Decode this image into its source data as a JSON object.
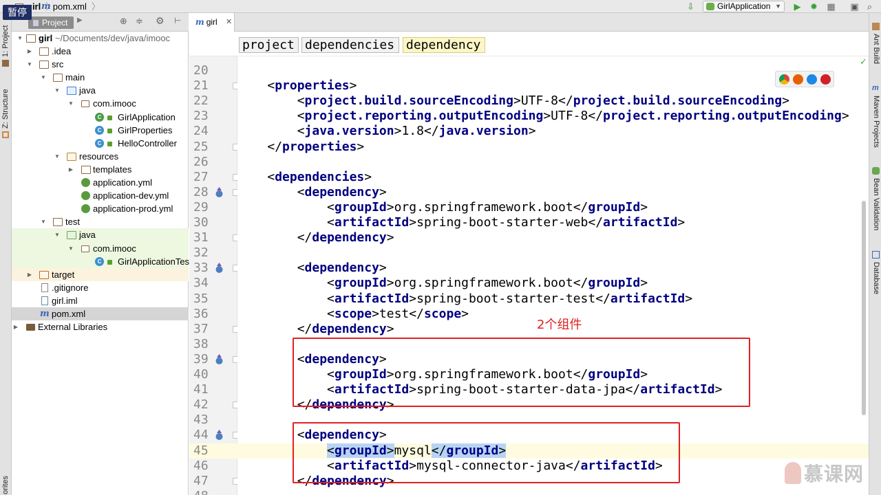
{
  "topbar": {
    "crumbs": [
      "girl",
      "pom.xml"
    ],
    "pause_label": "暂停",
    "run_config": "GirlApplication"
  },
  "left_strip": {
    "project_label": "1: Project",
    "structure_label": "Z: Structure",
    "favorites_label": "orites"
  },
  "right_strip": {
    "tools": [
      "Ant Build",
      "Maven Projects",
      "Bean Validation",
      "Database"
    ]
  },
  "project_panel": {
    "title": "Project",
    "tree": [
      {
        "label": "girl",
        "suffix": "~/Documents/dev/java/imooc",
        "bold": true
      },
      {
        "label": ".idea"
      },
      {
        "label": "src"
      },
      {
        "label": "main"
      },
      {
        "label": "java"
      },
      {
        "label": "com.imooc"
      },
      {
        "label": "GirlApplication"
      },
      {
        "label": "GirlProperties"
      },
      {
        "label": "HelloController"
      },
      {
        "label": "resources"
      },
      {
        "label": "templates"
      },
      {
        "label": "application.yml"
      },
      {
        "label": "application-dev.yml"
      },
      {
        "label": "application-prod.yml"
      },
      {
        "label": "test"
      },
      {
        "label": "java"
      },
      {
        "label": "com.imooc"
      },
      {
        "label": "GirlApplicationTests"
      },
      {
        "label": "target"
      },
      {
        "label": ".gitignore"
      },
      {
        "label": "girl.iml"
      },
      {
        "label": "pom.xml"
      },
      {
        "label": "External Libraries"
      }
    ]
  },
  "editor": {
    "tab_label": "girl",
    "breadcrumb": [
      "project",
      "dependencies",
      "dependency"
    ],
    "lines": [
      {
        "n": "20",
        "text": ""
      },
      {
        "n": "21",
        "text": "    <properties>"
      },
      {
        "n": "22",
        "text": "        <project.build.sourceEncoding>UTF-8</project.build.sourceEncoding>"
      },
      {
        "n": "23",
        "text": "        <project.reporting.outputEncoding>UTF-8</project.reporting.outputEncoding>"
      },
      {
        "n": "24",
        "text": "        <java.version>1.8</java.version>"
      },
      {
        "n": "25",
        "text": "    </properties>"
      },
      {
        "n": "26",
        "text": ""
      },
      {
        "n": "27",
        "text": "    <dependencies>"
      },
      {
        "n": "28",
        "text": "        <dependency>"
      },
      {
        "n": "29",
        "text": "            <groupId>org.springframework.boot</groupId>"
      },
      {
        "n": "30",
        "text": "            <artifactId>spring-boot-starter-web</artifactId>"
      },
      {
        "n": "31",
        "text": "        </dependency>"
      },
      {
        "n": "32",
        "text": ""
      },
      {
        "n": "33",
        "text": "        <dependency>"
      },
      {
        "n": "34",
        "text": "            <groupId>org.springframework.boot</groupId>"
      },
      {
        "n": "35",
        "text": "            <artifactId>spring-boot-starter-test</artifactId>"
      },
      {
        "n": "36",
        "text": "            <scope>test</scope>"
      },
      {
        "n": "37",
        "text": "        </dependency>"
      },
      {
        "n": "38",
        "text": ""
      },
      {
        "n": "39",
        "text": "        <dependency>"
      },
      {
        "n": "40",
        "text": "            <groupId>org.springframework.boot</groupId>"
      },
      {
        "n": "41",
        "text": "            <artifactId>spring-boot-starter-data-jpa</artifactId>"
      },
      {
        "n": "42",
        "text": "        </dependency>"
      },
      {
        "n": "43",
        "text": ""
      },
      {
        "n": "44",
        "text": "        <dependency>"
      },
      {
        "n": "45",
        "text": "            <groupId>mysql</groupId>"
      },
      {
        "n": "46",
        "text": "            <artifactId>mysql-connector-java</artifactId>"
      },
      {
        "n": "47",
        "text": "        </dependency>"
      },
      {
        "n": "48",
        "text": ""
      }
    ],
    "annotation": "2个组件"
  },
  "watermark": "慕课网",
  "colors": {
    "annotation_red": "#e02020",
    "tag_navy": "#000080"
  }
}
